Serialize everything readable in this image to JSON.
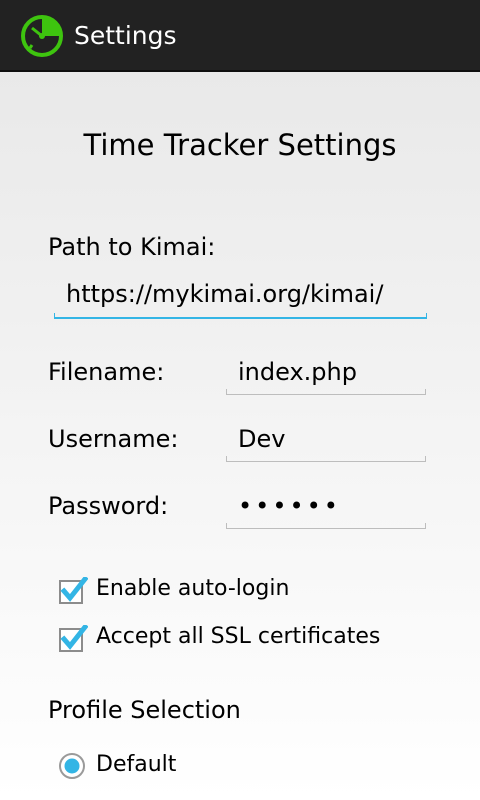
{
  "action_bar": {
    "title": "Settings",
    "icon": "stopwatch-icon"
  },
  "page": {
    "title": "Time Tracker Settings"
  },
  "path": {
    "label": "Path to Kimai:",
    "value": "https://mykimai.org/kimai/"
  },
  "filename": {
    "label": "Filename:",
    "value": "index.php"
  },
  "username": {
    "label": "Username:",
    "value": "Dev"
  },
  "password": {
    "label": "Password:",
    "value": "••••••"
  },
  "options": {
    "auto_login": {
      "label": "Enable auto-login",
      "checked": true
    },
    "accept_ssl": {
      "label": "Accept all SSL certificates",
      "checked": true
    }
  },
  "profile": {
    "title": "Profile Selection",
    "options": [
      {
        "label": "Default",
        "selected": true
      }
    ]
  },
  "colors": {
    "accent": "#33b5e5",
    "action_bar": "#222222",
    "icon_green": "#3ec40f"
  }
}
